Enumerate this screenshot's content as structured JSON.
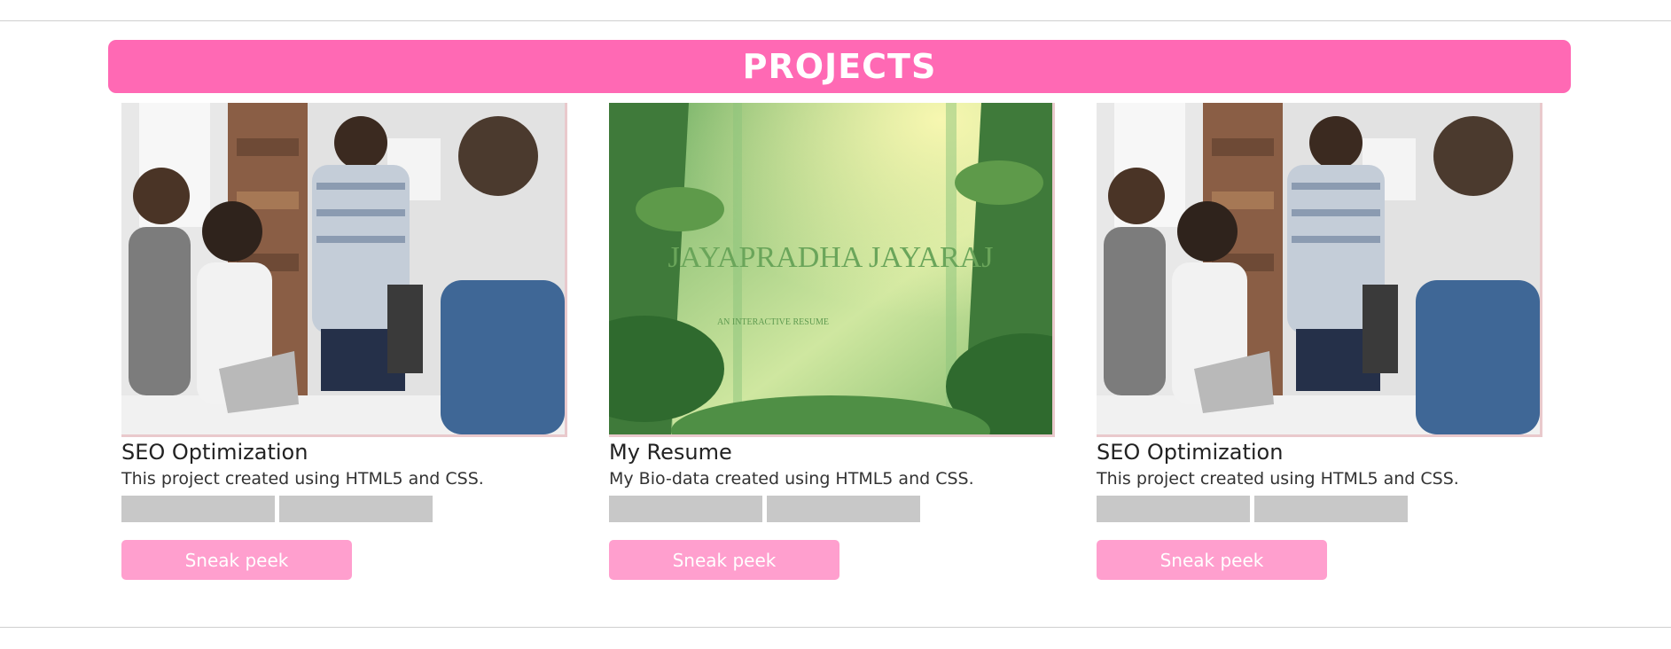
{
  "header": {
    "title": "PROJECTS"
  },
  "colors": {
    "banner": "#ff69b4",
    "button": "#ff9fce",
    "tag": "#c8c8c8"
  },
  "projects": [
    {
      "title": "SEO Optimization",
      "description": "This project created using HTML5 and CSS.",
      "image": "team-meeting-photo",
      "button_label": "Sneak peek"
    },
    {
      "title": "My Resume",
      "description": "My Bio-data created using HTML5 and CSS.",
      "image": "jungle-resume-banner",
      "image_heading": "JAYAPRADHA JAYARAJ",
      "image_subheading": "AN INTERACTIVE RESUME",
      "button_label": "Sneak peek"
    },
    {
      "title": "SEO Optimization",
      "description": "This project created using HTML5 and CSS.",
      "image": "team-meeting-photo",
      "button_label": "Sneak peek"
    }
  ]
}
